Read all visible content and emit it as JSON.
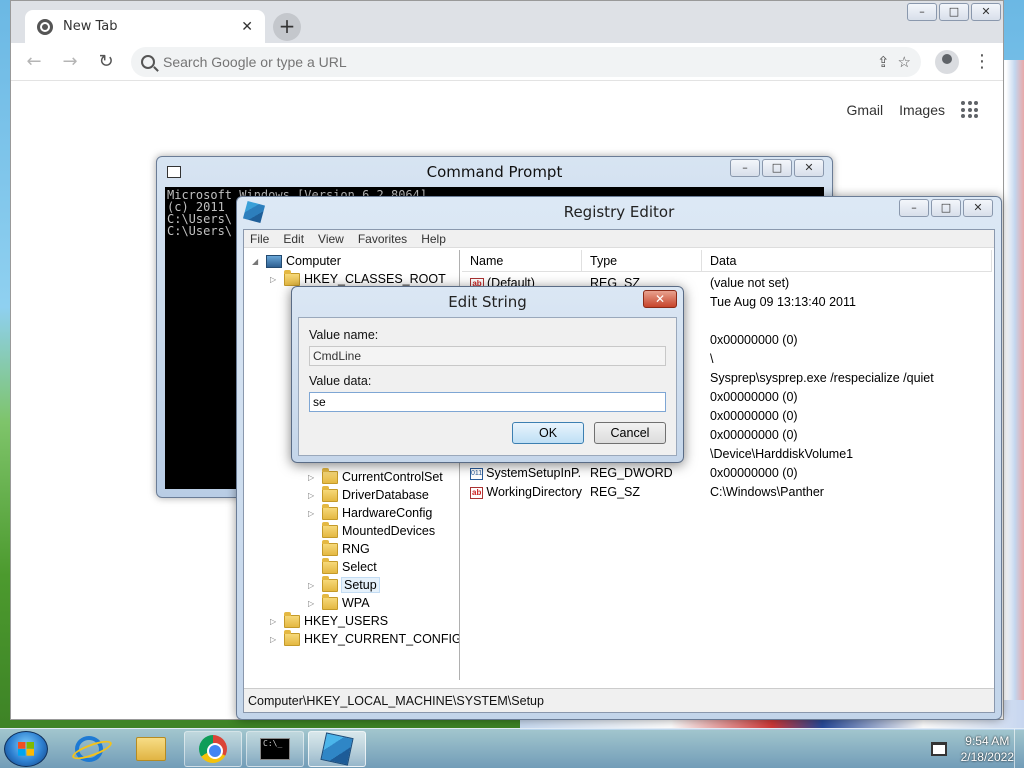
{
  "chrome": {
    "tab_title": "New Tab",
    "tab_close": "✕",
    "new_tab": "+",
    "omnibox_placeholder": "Search Google or type a URL",
    "links": [
      "Gmail",
      "Images"
    ]
  },
  "window_controls": {
    "minimize": "–",
    "maximize": "□",
    "close": "✕"
  },
  "cmd": {
    "title": "Command Prompt",
    "lines": [
      "Microsoft Windows [Version 6.2.8064]",
      "(c) 2011",
      "",
      "C:\\Users\\",
      "",
      "C:\\Users\\"
    ]
  },
  "registry": {
    "title": "Registry Editor",
    "menu": [
      "File",
      "Edit",
      "View",
      "Favorites",
      "Help"
    ],
    "tree": {
      "computer": "Computer",
      "hkcr": "HKEY_CLASSES_ROOT",
      "items": [
        "CurrentControlSet",
        "DriverDatabase",
        "HardwareConfig",
        "MountedDevices",
        "RNG",
        "Select",
        "Setup",
        "WPA"
      ],
      "hku": "HKEY_USERS",
      "hkcc": "HKEY_CURRENT_CONFIG"
    },
    "columns": {
      "name": "Name",
      "type": "Type",
      "data": "Data"
    },
    "rows": [
      {
        "name": "(Default)",
        "type": "REG_SZ",
        "data": "(value not set)",
        "icon": "ab"
      },
      {
        "name": "",
        "type": "",
        "data": "Tue Aug 09 13:13:40 2011",
        "icon": ""
      },
      {
        "name": "",
        "type": "",
        "data": "",
        "icon": ""
      },
      {
        "name": "",
        "type": "",
        "data": "0x00000000 (0)",
        "icon": ""
      },
      {
        "name": "",
        "type": "",
        "data": "\\",
        "icon": ""
      },
      {
        "name": "",
        "type": "",
        "data": "Sysprep\\sysprep.exe /respecialize /quiet",
        "icon": ""
      },
      {
        "name": "",
        "type": "",
        "data": "0x00000000 (0)",
        "icon": ""
      },
      {
        "name": "",
        "type": "",
        "data": "0x00000000 (0)",
        "icon": ""
      },
      {
        "name": "",
        "type": "",
        "data": "0x00000000 (0)",
        "icon": ""
      },
      {
        "name": "",
        "type": "",
        "data": "\\Device\\HarddiskVolume1",
        "icon": ""
      },
      {
        "name": "SystemSetupInP...",
        "type": "REG_DWORD",
        "data": "0x00000000 (0)",
        "icon": "bin"
      },
      {
        "name": "WorkingDirectory",
        "type": "REG_SZ",
        "data": "C:\\Windows\\Panther",
        "icon": "ab"
      }
    ],
    "status": "Computer\\HKEY_LOCAL_MACHINE\\SYSTEM\\Setup"
  },
  "dialog": {
    "title": "Edit String",
    "close": "✕",
    "value_name_label": "Value name:",
    "value_name": "CmdLine",
    "value_data_label": "Value data:",
    "value_data": "se",
    "ok": "OK",
    "cancel": "Cancel"
  },
  "taskbar": {
    "time": "9:54 AM",
    "date": "2/18/2022",
    "cmd_icon_text": "C:\\_"
  }
}
